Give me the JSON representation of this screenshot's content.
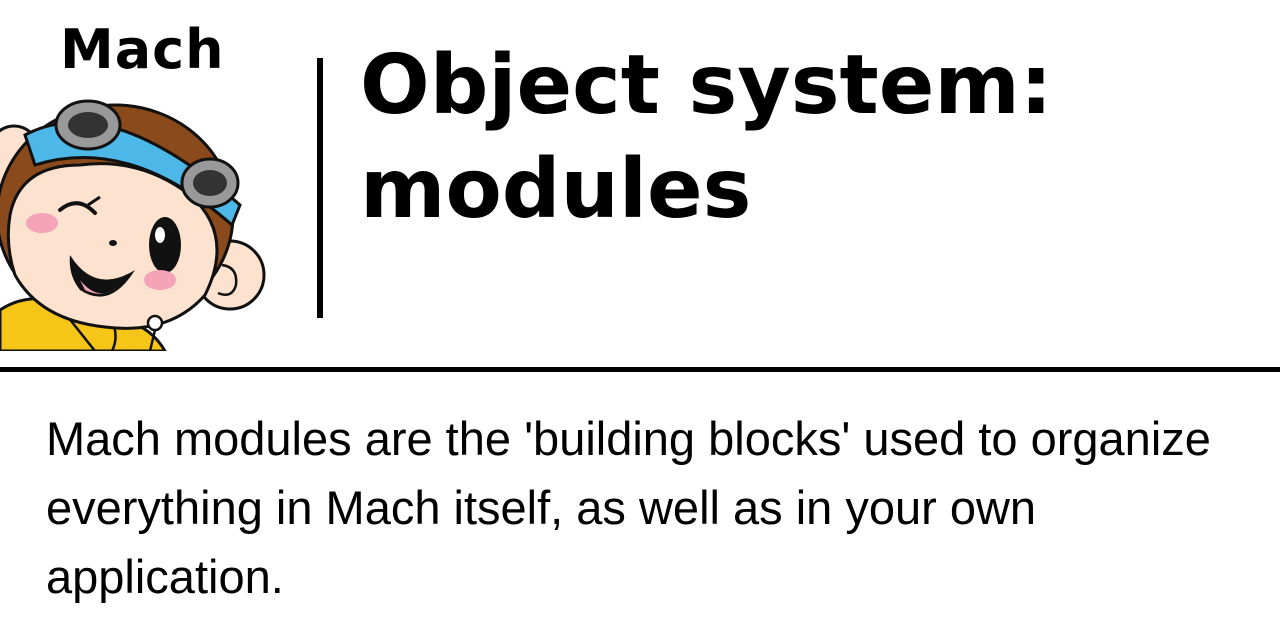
{
  "brand": {
    "name": "Mach"
  },
  "mascot": {
    "icon": "monkey-mascot-icon"
  },
  "title": {
    "line1": "Object system:",
    "line2": "modules"
  },
  "description": "Mach modules are the 'building blocks' used to organize everything in Mach itself, as well as in your own application.",
  "colors": {
    "background": "#ffffff",
    "text": "#000000",
    "goggle_band": "#4db8e8",
    "fur": "#8b4a1c",
    "face": "#fde3cf",
    "jacket": "#f5c518"
  }
}
